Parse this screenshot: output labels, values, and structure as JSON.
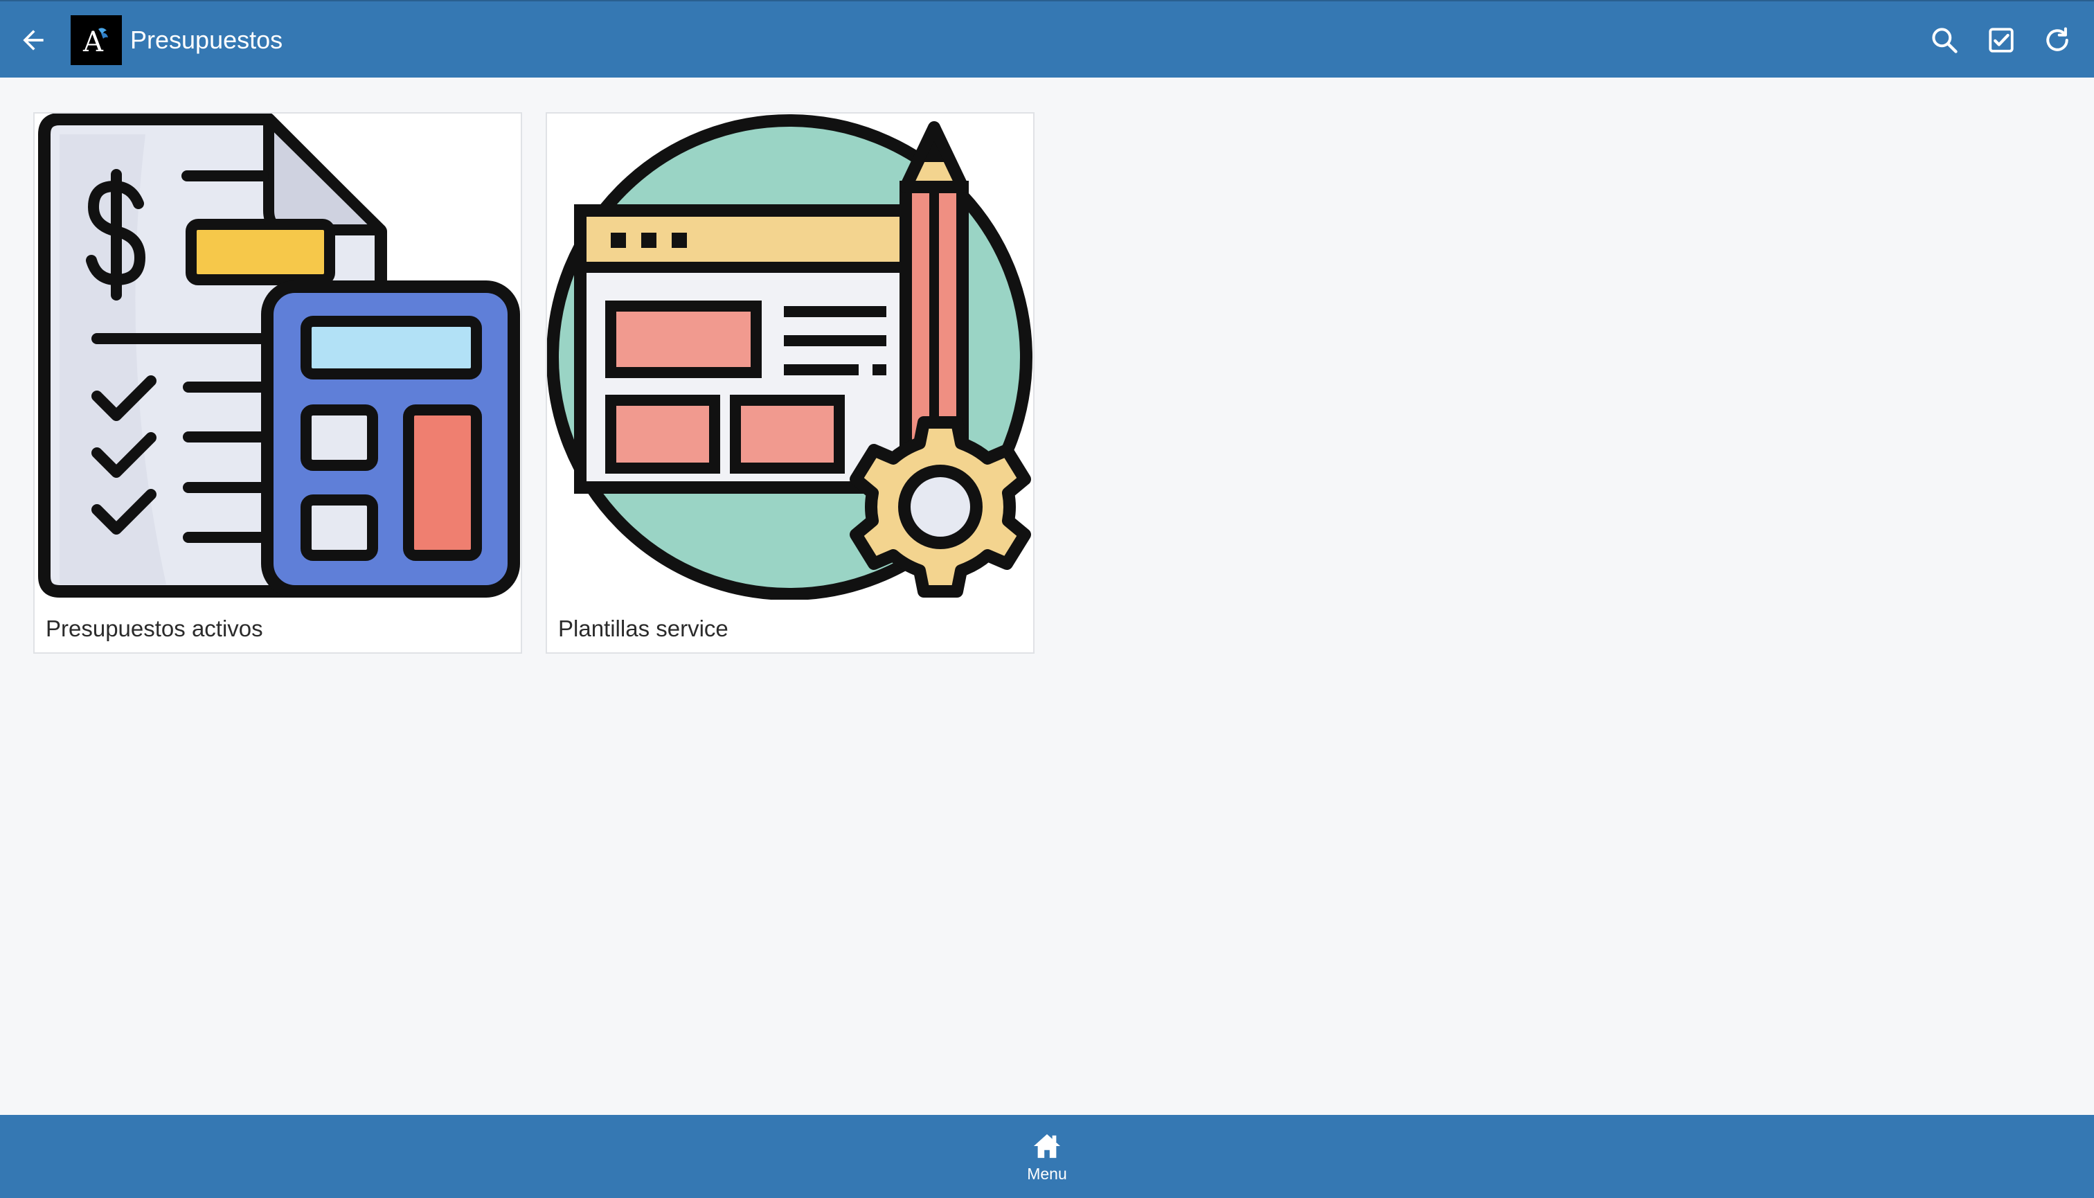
{
  "header": {
    "title": "Presupuestos",
    "logo_text": "A",
    "icons": {
      "back": "arrow-left-icon",
      "search": "search-icon",
      "check": "checkbox-icon",
      "refresh": "refresh-icon"
    }
  },
  "cards": [
    {
      "label": "Presupuestos activos",
      "icon": "budget-calculator-icon"
    },
    {
      "label": "Plantillas service",
      "icon": "template-design-icon"
    }
  ],
  "bottom_nav": {
    "menu_label": "Menu",
    "menu_icon": "home-icon"
  },
  "colors": {
    "bar": "#3578b3",
    "background": "#f6f7f9"
  }
}
